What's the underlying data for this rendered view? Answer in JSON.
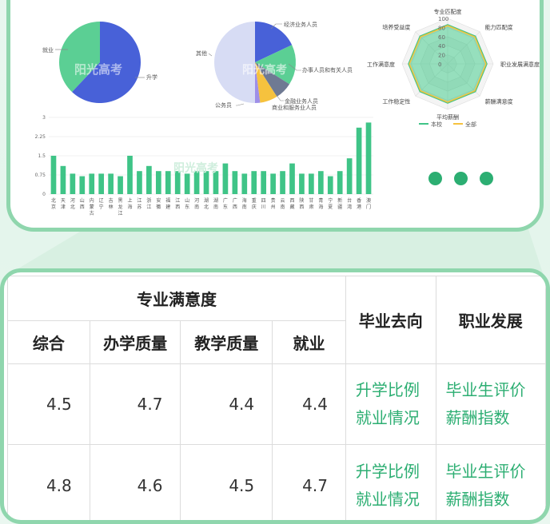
{
  "colors": {
    "accent": "#2cae72",
    "border": "#8fd6ad",
    "pie_green": "#5bcf94",
    "pie_blue": "#4861d8",
    "bar": "#3fc487"
  },
  "pie1": {
    "labels": [
      "就业",
      "升学"
    ],
    "values": [
      38,
      62
    ]
  },
  "pie2": {
    "labels": [
      "经济业务人员",
      "办事人员和有关人员",
      "金融业务人员",
      "商业和服务业人员",
      "公务员",
      "其他"
    ],
    "values": [
      18,
      16,
      7,
      7,
      2,
      50
    ]
  },
  "radar": {
    "axes": [
      "专业匹配度",
      "能力匹配度",
      "职业发展满意度",
      "薪酬满意度",
      "平均薪酬",
      "工作稳定性",
      "工作满意度",
      "培养受益度"
    ],
    "ticks": [
      "0",
      "20",
      "40",
      "60",
      "80",
      "100"
    ],
    "legend": [
      "本校",
      "全部"
    ]
  },
  "chart_data": {
    "type": "bar",
    "categories": [
      "北京",
      "天津",
      "河北",
      "山西",
      "内蒙古",
      "辽宁",
      "吉林",
      "黑龙江",
      "上海",
      "江苏",
      "浙江",
      "安徽",
      "福建",
      "江西",
      "山东",
      "河南",
      "湖北",
      "湖南",
      "广东",
      "广西",
      "海南",
      "重庆",
      "四川",
      "贵州",
      "云南",
      "西藏",
      "陕西",
      "甘肃",
      "青海",
      "宁夏",
      "新疆",
      "台湾",
      "香港",
      "澳门"
    ],
    "values": [
      1.5,
      1.1,
      0.8,
      0.7,
      0.8,
      0.8,
      0.8,
      0.7,
      1.5,
      0.9,
      1.1,
      0.9,
      0.9,
      0.9,
      0.8,
      0.9,
      0.9,
      0.9,
      1.2,
      0.9,
      0.8,
      0.9,
      0.9,
      0.8,
      0.9,
      1.2,
      0.8,
      0.8,
      0.9,
      0.7,
      0.9,
      1.4,
      2.6,
      2.8
    ],
    "ylim": [
      0,
      3
    ],
    "yticks": [
      "0",
      "0.75",
      "1.5",
      "2.25",
      "3"
    ]
  },
  "watermark": "阳光高考",
  "table": {
    "group_header": "专业满意度",
    "sub_headers": [
      "综合",
      "办学质量",
      "教学质量",
      "就业"
    ],
    "col_graduation": "毕业去向",
    "col_career": "职业发展",
    "rows": [
      {
        "scores": [
          "4.5",
          "4.7",
          "4.4",
          "4.4"
        ],
        "grad_links": [
          "升学比例",
          "就业情况"
        ],
        "career_links": [
          "毕业生评价",
          "薪酬指数"
        ]
      },
      {
        "scores": [
          "4.8",
          "4.6",
          "4.5",
          "4.7"
        ],
        "grad_links": [
          "升学比例",
          "就业情况"
        ],
        "career_links": [
          "毕业生评价",
          "薪酬指数"
        ]
      }
    ]
  }
}
